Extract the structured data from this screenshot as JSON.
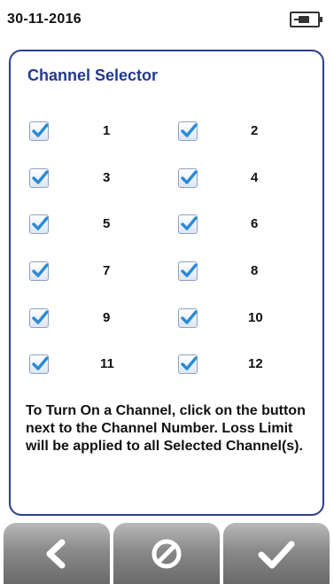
{
  "status_bar": {
    "date": "30-11-2016",
    "battery_icon": "battery-charging-icon"
  },
  "panel": {
    "title": "Channel Selector",
    "channels": [
      {
        "label": "1",
        "checked": true
      },
      {
        "label": "2",
        "checked": true
      },
      {
        "label": "3",
        "checked": true
      },
      {
        "label": "4",
        "checked": true
      },
      {
        "label": "5",
        "checked": true
      },
      {
        "label": "6",
        "checked": true
      },
      {
        "label": "7",
        "checked": true
      },
      {
        "label": "8",
        "checked": true
      },
      {
        "label": "9",
        "checked": true
      },
      {
        "label": "10",
        "checked": true
      },
      {
        "label": "11",
        "checked": true
      },
      {
        "label": "12",
        "checked": true
      }
    ],
    "note": "To Turn On a Channel, click on the button next to the Channel Number. Loss Limit will be applied to all Selected Channel(s)."
  },
  "toolbar": {
    "back_icon": "chevron-left-icon",
    "cancel_icon": "cancel-icon",
    "confirm_icon": "check-icon"
  },
  "colors": {
    "accent": "#23398e",
    "check": "#2a8bd6",
    "button": "#8a8a8a"
  }
}
